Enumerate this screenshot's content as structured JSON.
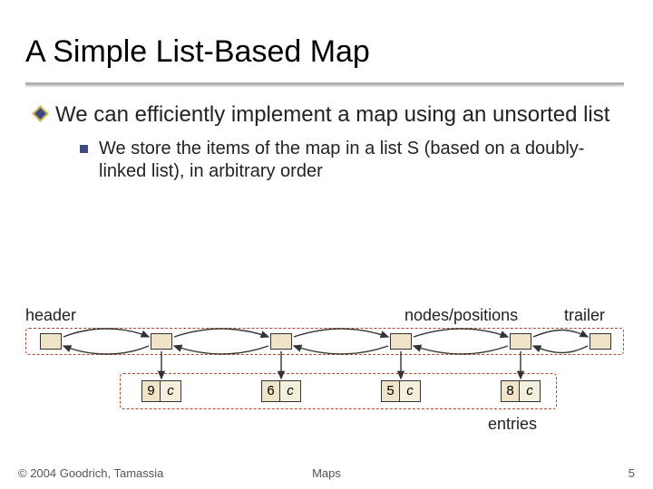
{
  "title": "A Simple List-Based Map",
  "bullet": "We can efficiently implement a map using an unsorted list",
  "subbullet": "We store the items of the map in a list S (based on a doubly-linked list), in arbitrary order",
  "labels": {
    "header": "header",
    "trailer": "trailer",
    "nodespos": "nodes/positions",
    "entries": "entries"
  },
  "entries": [
    {
      "k": "9",
      "v": "c"
    },
    {
      "k": "6",
      "v": "c"
    },
    {
      "k": "5",
      "v": "c"
    },
    {
      "k": "8",
      "v": "c"
    }
  ],
  "footer": {
    "left": "© 2004 Goodrich, Tamassia",
    "center": "Maps",
    "right": "5"
  }
}
